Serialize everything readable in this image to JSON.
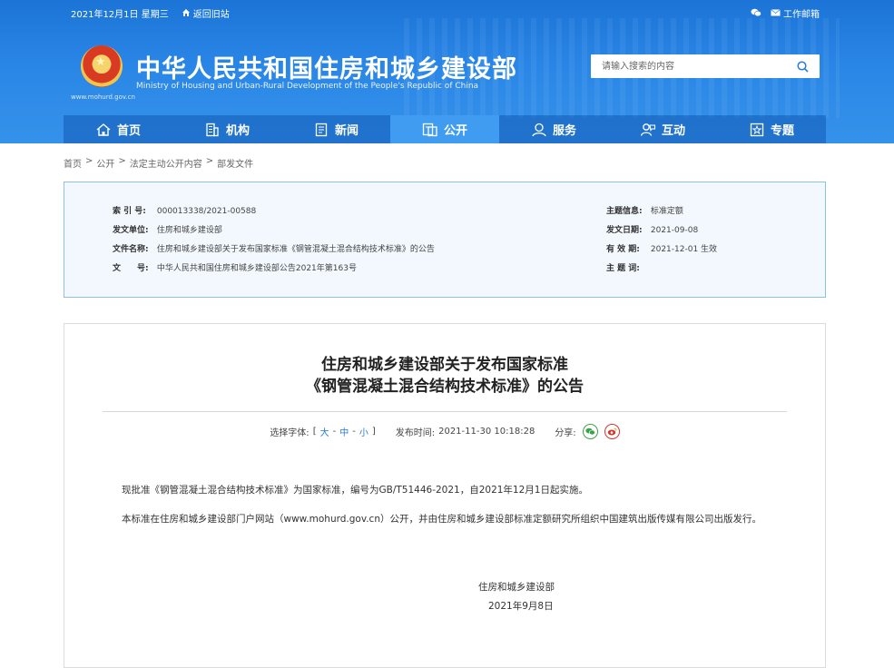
{
  "topbar": {
    "date": "2021年12月1日 星期三",
    "old_site": "返回旧站",
    "mail": "工作邮箱"
  },
  "header": {
    "site_url": "www.mohurd.gov.cn",
    "title": "中华人民共和国住房和城乡建设部",
    "subtitle": "Ministry of Housing and Urban-Rural Development of the People's Republic of China"
  },
  "search": {
    "placeholder": "请输入搜索的内容"
  },
  "nav": {
    "items": [
      {
        "label": "首页",
        "icon": "house-icon"
      },
      {
        "label": "机构",
        "icon": "building-icon"
      },
      {
        "label": "新闻",
        "icon": "newspaper-icon"
      },
      {
        "label": "公开",
        "icon": "document-icon"
      },
      {
        "label": "服务",
        "icon": "person-icon"
      },
      {
        "label": "互动",
        "icon": "chat-person-icon"
      },
      {
        "label": "专题",
        "icon": "star-box-icon"
      }
    ],
    "active": "公开"
  },
  "breadcrumb": {
    "home": "首页",
    "sep": ">",
    "open": "公开",
    "law": "法定主动公开内容",
    "docs": "部发文件"
  },
  "meta": {
    "index_label": "索 引 号:",
    "index_value": "000013338/2021-00588",
    "unit_label": "发文单位:",
    "unit_value": "住房和城乡建设部",
    "name_label": "文件名称:",
    "name_value": "住房和城乡建设部关于发布国家标准《钢管混凝土混合结构技术标准》的公告",
    "docno_label": "文　　号:",
    "docno_value": "中华人民共和国住房和城乡建设部公告2021年第163号",
    "topic_label": "主题信息:",
    "topic_value": "标准定额",
    "date_label": "发文日期:",
    "date_value": "2021-09-08",
    "valid_label": "有 效 期:",
    "valid_value": "2021-12-01 生效",
    "keyword_label": "主 题 词:",
    "keyword_value": ""
  },
  "article": {
    "title_line1": "住房和城乡建设部关于发布国家标准",
    "title_line2": "《钢管混凝土混合结构技术标准》的公告",
    "font_label": "选择字体:",
    "font_open": "[",
    "font_large": "大",
    "font_mid": "中",
    "font_small": "小",
    "font_dash": "-",
    "font_close": "]",
    "publish_label": "发布时间:",
    "publish_time": "2021-11-30 10:18:28",
    "share_label": "分享:",
    "para1": "现批准《钢管混凝土混合结构技术标准》为国家标准，编号为GB/T51446-2021，自2021年12月1日起实施。",
    "para2": "本标准在住房和城乡建设部门户网站（www.mohurd.gov.cn）公开，并由住房和城乡建设部标准定额研究所组织中国建筑出版传媒有限公司出版发行。",
    "sign_org": "住房和城乡建设部",
    "sign_date": "2021年9月8日"
  }
}
